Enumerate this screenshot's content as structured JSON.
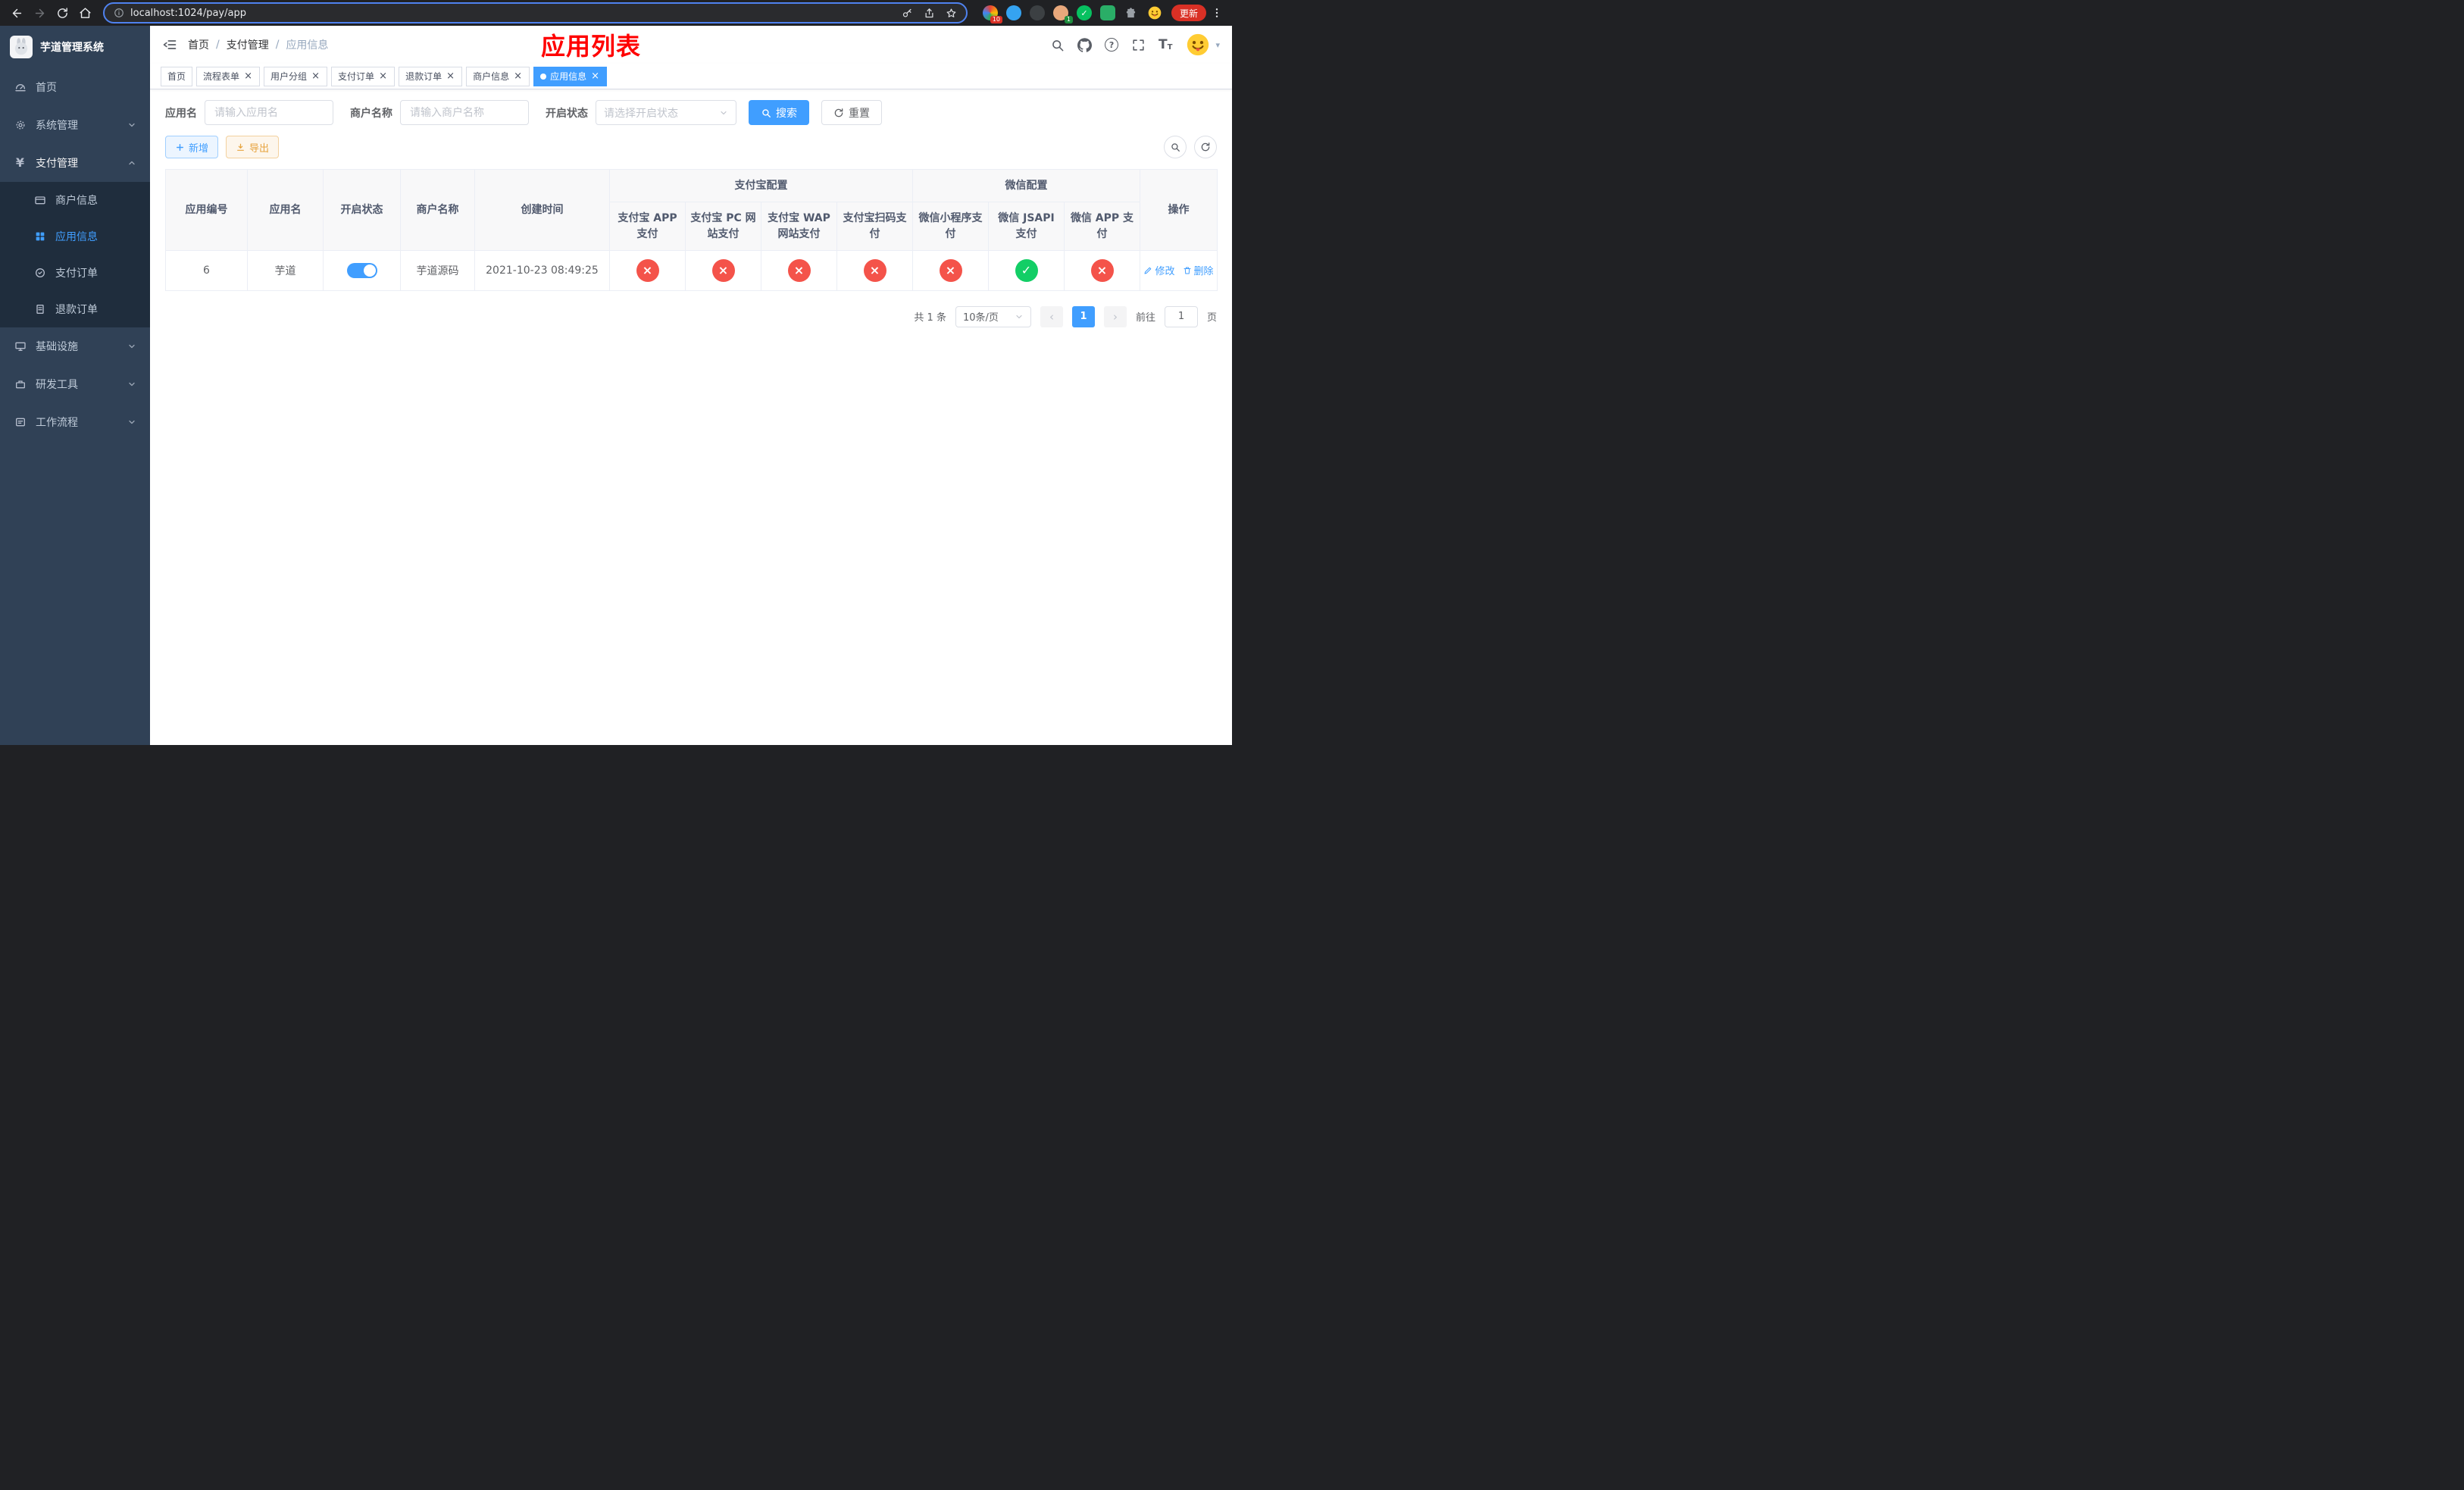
{
  "browser": {
    "url": "localhost:1024/pay/app",
    "update_label": "更新",
    "extension_badges": {
      "apps": "10",
      "profile": "1"
    }
  },
  "glyphs": {
    "close": "×",
    "check": "✓",
    "cross": "×",
    "slash": "/",
    "caret_down": "▾",
    "chev_left": "‹",
    "chev_right": "›",
    "yen": "¥",
    "question": "?",
    "font_large": "T",
    "font_small": "T"
  },
  "sidebar": {
    "title": "芋道管理系统",
    "menu": [
      {
        "label": "首页"
      },
      {
        "label": "系统管理"
      },
      {
        "label": "支付管理"
      },
      {
        "label": "基础设施"
      },
      {
        "label": "研发工具"
      },
      {
        "label": "工作流程"
      }
    ],
    "payment_children": [
      {
        "label": "商户信息"
      },
      {
        "label": "应用信息"
      },
      {
        "label": "支付订单"
      },
      {
        "label": "退款订单"
      }
    ]
  },
  "header": {
    "breadcrumb": [
      "首页",
      "支付管理",
      "应用信息"
    ],
    "title": "应用列表"
  },
  "tabs": [
    {
      "label": "首页"
    },
    {
      "label": "流程表单"
    },
    {
      "label": "用户分组"
    },
    {
      "label": "支付订单"
    },
    {
      "label": "退款订单"
    },
    {
      "label": "商户信息"
    },
    {
      "label": "应用信息"
    }
  ],
  "filters": {
    "app_name_label": "应用名",
    "app_name_placeholder": "请输入应用名",
    "merchant_label": "商户名称",
    "merchant_placeholder": "请输入商户名称",
    "status_label": "开启状态",
    "status_placeholder": "请选择开启状态",
    "search_label": "搜索",
    "reset_label": "重置"
  },
  "toolbar": {
    "add_label": "新增",
    "export_label": "导出"
  },
  "table": {
    "columns": {
      "app_no": "应用编号",
      "app_name": "应用名",
      "status": "开启状态",
      "merchant": "商户名称",
      "created": "创建时间",
      "ops": "操作"
    },
    "groups": {
      "alipay": "支付宝配置",
      "wechat": "微信配置"
    },
    "sub": [
      "支付宝 APP 支付",
      "支付宝 PC 网站支付",
      "支付宝 WAP 网站支付",
      "支付宝扫码支付",
      "微信小程序支付",
      "微信 JSAPI 支付",
      "微信 APP 支付"
    ],
    "row": {
      "app_no": "6",
      "app_name": "芋道",
      "enabled": true,
      "merchant": "芋道源码",
      "created": "2021-10-23 08:49:25",
      "statuses": [
        "fail",
        "fail",
        "fail",
        "fail",
        "fail",
        "success",
        "fail"
      ],
      "edit_label": "修改",
      "delete_label": "删除"
    }
  },
  "pagination": {
    "total": "共 1 条",
    "page_size": "10条/页",
    "page": "1",
    "goto_label": "前往",
    "goto_value": "1",
    "goto_unit": "页"
  }
}
